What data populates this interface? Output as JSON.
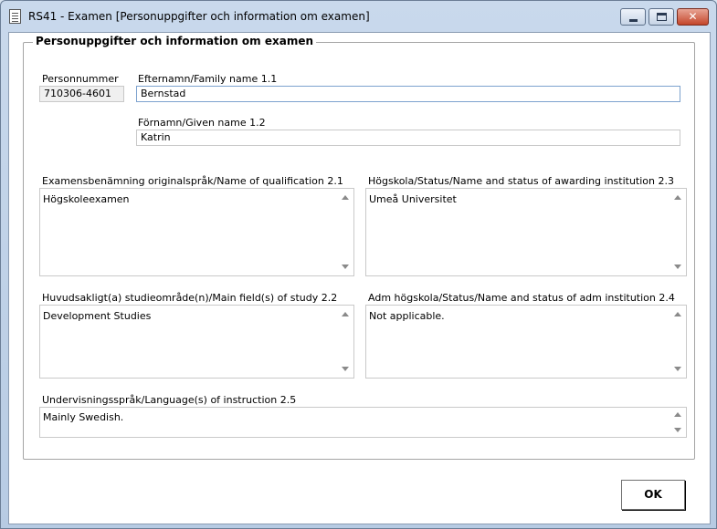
{
  "window": {
    "title": "RS41 - Examen [Personuppgifter och information om examen]"
  },
  "group": {
    "legend": "Personuppgifter och information om examen"
  },
  "personnummer": {
    "label": "Personnummer",
    "value": "710306-4601"
  },
  "family_name": {
    "label": "Efternamn/Family name  1.1",
    "value": "Bernstad"
  },
  "given_name": {
    "label": "Förnamn/Given name  1.2",
    "value": "Katrin"
  },
  "qualification": {
    "label": "Examensbenämning originalspråk/Name of qualification  2.1",
    "value": "Högskoleexamen"
  },
  "awarding_institution": {
    "label": "Högskola/Status/Name and status of awarding institution  2.3",
    "value": "Umeå Universitet"
  },
  "main_field": {
    "label": "Huvudsakligt(a) studieområde(n)/Main field(s) of study   2.2",
    "value": "Development Studies"
  },
  "adm_institution": {
    "label": "Adm högskola/Status/Name and status of adm institution  2.4",
    "value": "Not applicable."
  },
  "language": {
    "label": "Undervisningsspråk/Language(s) of instruction  2.5",
    "value": "Mainly Swedish."
  },
  "buttons": {
    "ok": "OK"
  },
  "icons": {
    "app": "document-icon",
    "minimize": "minimize-icon",
    "maximize": "maximize-icon",
    "close": "close-icon",
    "scroll_up": "scroll-up-arrow-icon",
    "scroll_down": "scroll-down-arrow-icon"
  },
  "colors": {
    "window_frame": "#b7cbe3",
    "close_button": "#c4462b",
    "focus_border": "#7da2ce"
  }
}
